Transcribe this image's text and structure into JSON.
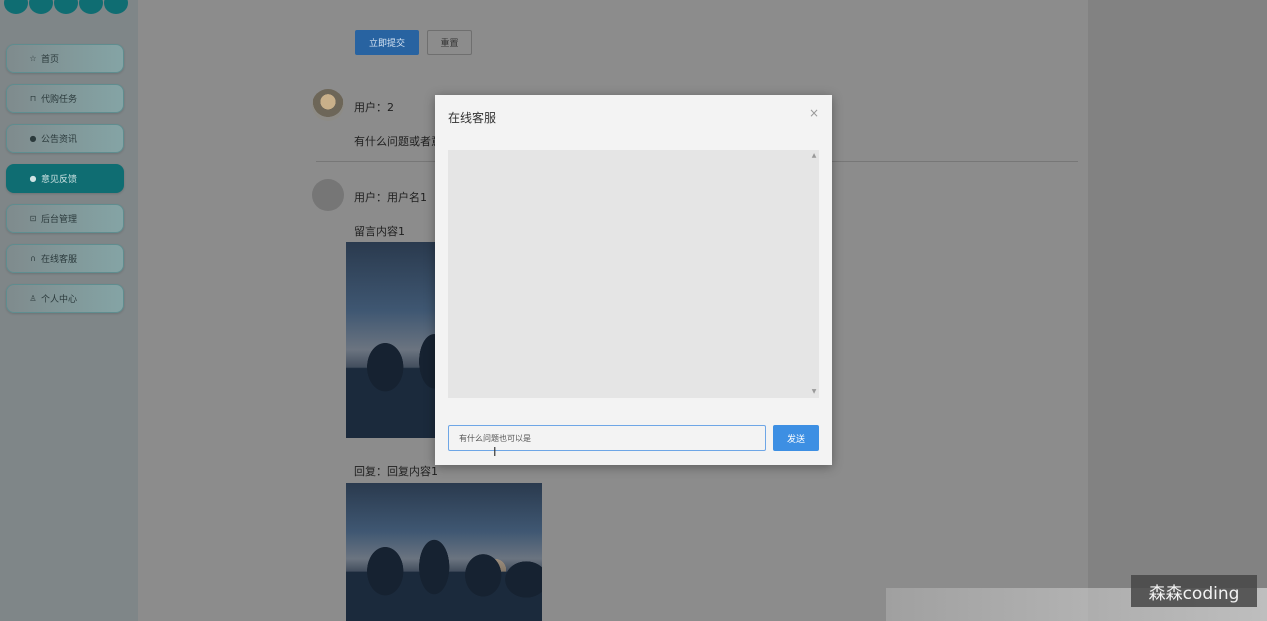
{
  "sidebar": {
    "items": [
      {
        "label": "首页",
        "icon": "star-icon",
        "glyph": "☆"
      },
      {
        "label": "代购任务",
        "icon": "bag-icon",
        "glyph": "⊓"
      },
      {
        "label": "公告资讯",
        "icon": "info-icon",
        "glyph": "●"
      },
      {
        "label": "意见反馈",
        "icon": "question-icon",
        "glyph": "●",
        "active": true
      },
      {
        "label": "后台管理",
        "icon": "briefcase-icon",
        "glyph": "⊡"
      },
      {
        "label": "在线客服",
        "icon": "headset-icon",
        "glyph": "∩"
      },
      {
        "label": "个人中心",
        "icon": "user-icon",
        "glyph": "♙"
      }
    ]
  },
  "form": {
    "submit_label": "立即提交",
    "reset_label": "重置"
  },
  "comments": [
    {
      "user": "用户：2",
      "content": "有什么问题或者意"
    },
    {
      "user": "用户：用户名1",
      "content": "留言内容1",
      "reply": "回复：回复内容1"
    }
  ],
  "modal": {
    "title": "在线客服",
    "close_glyph": "×",
    "input_value": "有什么问题也可以是",
    "send_label": "发送"
  },
  "watermark": "森森coding",
  "colors": {
    "accent": "#3d8fe3",
    "sidebar_active": "#0f6d72"
  }
}
